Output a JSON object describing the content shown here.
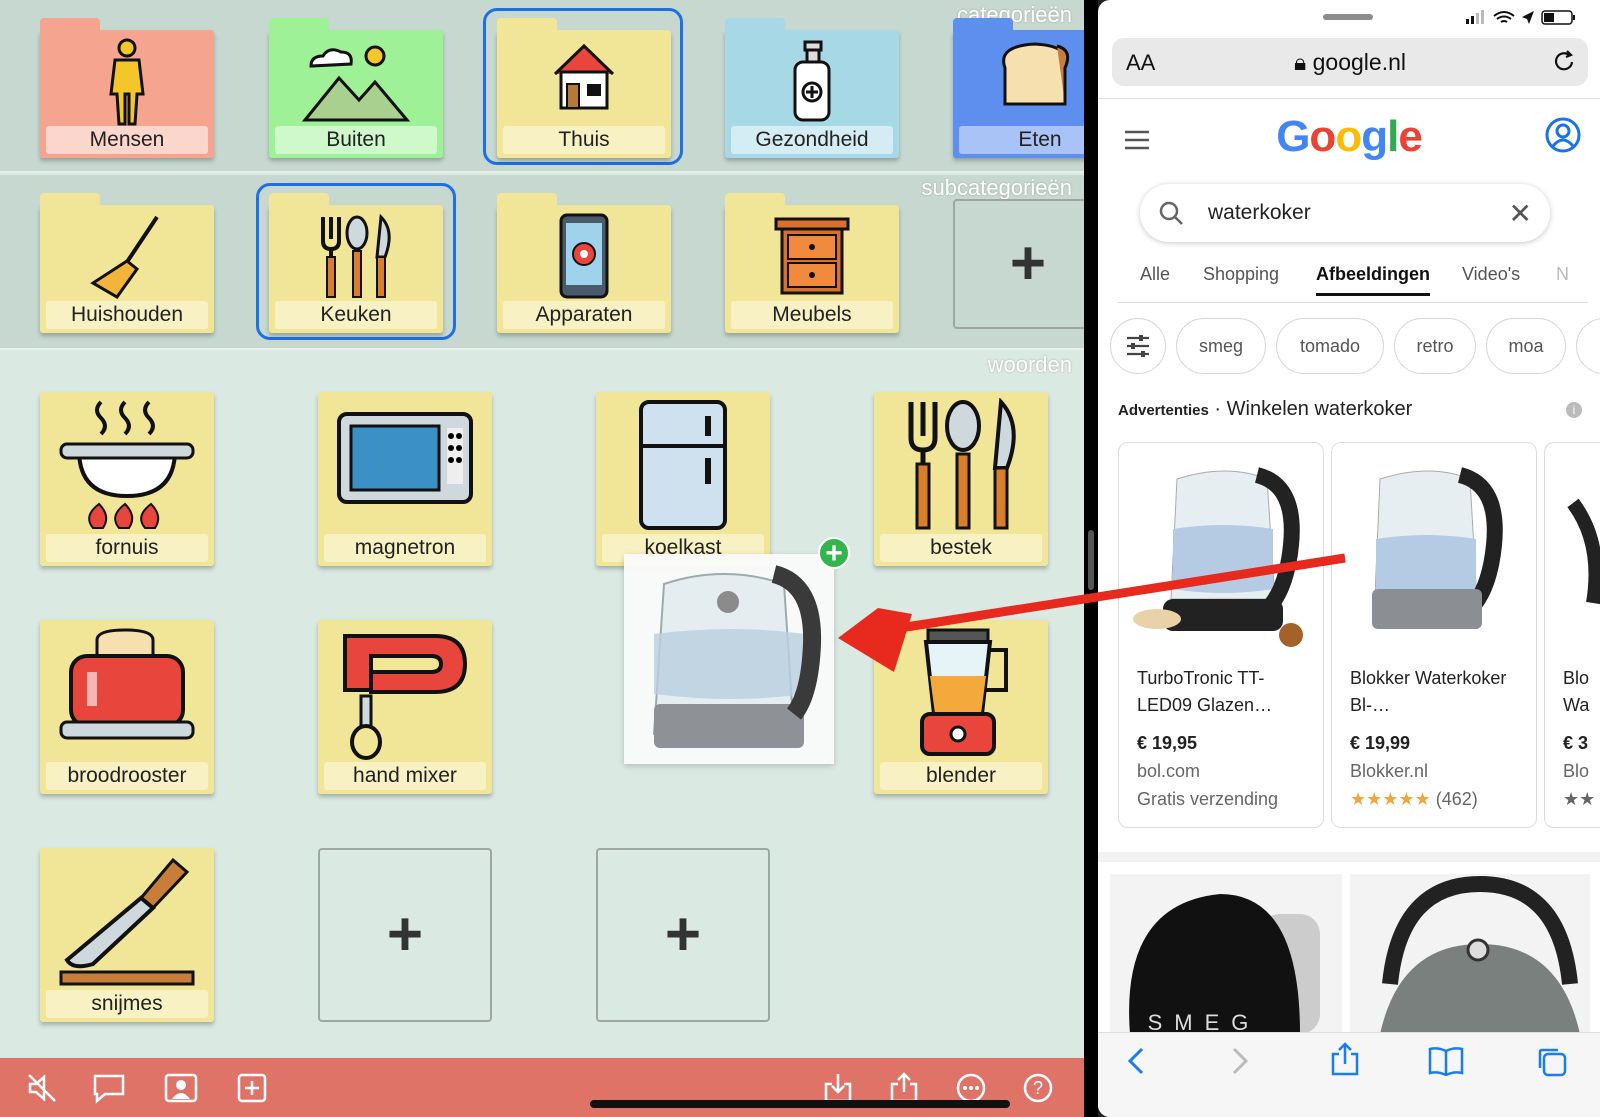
{
  "app": {
    "section_categories": "categorieën",
    "section_subcategories": "subcategorieën",
    "section_words": "woorden",
    "categories": [
      {
        "label": "Mensen",
        "icon": "person-icon",
        "color": "#f5a58f",
        "label_bg": "#fbd6cc"
      },
      {
        "label": "Buiten",
        "icon": "mountains-sun-icon",
        "color": "#9ef196",
        "label_bg": "#cff8cb"
      },
      {
        "label": "Thuis",
        "icon": "house-icon",
        "color": "#f1e597",
        "label_bg": "#f8f1c3"
      },
      {
        "label": "Gezondheid",
        "icon": "sanitizer-icon",
        "color": "#a7d8e6",
        "label_bg": "#d4ecf3"
      },
      {
        "label": "Eten",
        "icon": "bread-icon",
        "color": "#5e8fef",
        "label_bg": "#a9c3f6"
      }
    ],
    "subcategories": [
      {
        "label": "Huishouden",
        "icon": "broom-icon"
      },
      {
        "label": "Keuken",
        "icon": "cutlery-icon"
      },
      {
        "label": "Apparaten",
        "icon": "phone-settings-icon"
      },
      {
        "label": "Meubels",
        "icon": "cabinet-icon"
      }
    ],
    "add_symbol": "+",
    "words": [
      {
        "label": "fornuis",
        "icon": "stove-pot-icon"
      },
      {
        "label": "magnetron",
        "icon": "microwave-icon"
      },
      {
        "label": "koelkast",
        "icon": "fridge-icon"
      },
      {
        "label": "bestek",
        "icon": "cutlery-icon"
      },
      {
        "label": "broodrooster",
        "icon": "toaster-icon"
      },
      {
        "label": "hand mixer",
        "icon": "hand-mixer-icon"
      },
      {
        "label": "blender",
        "icon": "blender-icon"
      },
      {
        "label": "snijmes",
        "icon": "knife-board-icon"
      }
    ],
    "drag_badge": "+",
    "bottom_icons": [
      "mute-icon",
      "speech-bubble-icon",
      "contact-icon",
      "add-square-icon",
      "import-icon",
      "share-icon",
      "more-icon",
      "help-icon"
    ]
  },
  "safari": {
    "aa": "AA",
    "url": "google.nl",
    "logo": "Google",
    "query": "waterkoker",
    "tabs": [
      "Alle",
      "Shopping",
      "Afbeeldingen",
      "Video's",
      "N"
    ],
    "active_tab": "Afbeeldingen",
    "chips": [
      "smeg",
      "tomado",
      "retro",
      "moa"
    ],
    "ads_label": "Advertenties",
    "ads_title": "Winkelen waterkoker",
    "products": [
      {
        "title": "TurboTronic TT-LED09 Glazen…",
        "price": "€ 19,95",
        "shop": "bol.com",
        "extra": "Gratis verzending"
      },
      {
        "title": "Blokker Waterkoker Bl-…",
        "price": "€ 19,99",
        "shop": "Blokker.nl",
        "stars": "★★★★★",
        "reviews": "(462)"
      },
      {
        "title": "Blo Wa",
        "price": "€ 3",
        "shop": "Blo",
        "stars": "★★"
      }
    ],
    "brand_text": "SMEG"
  }
}
